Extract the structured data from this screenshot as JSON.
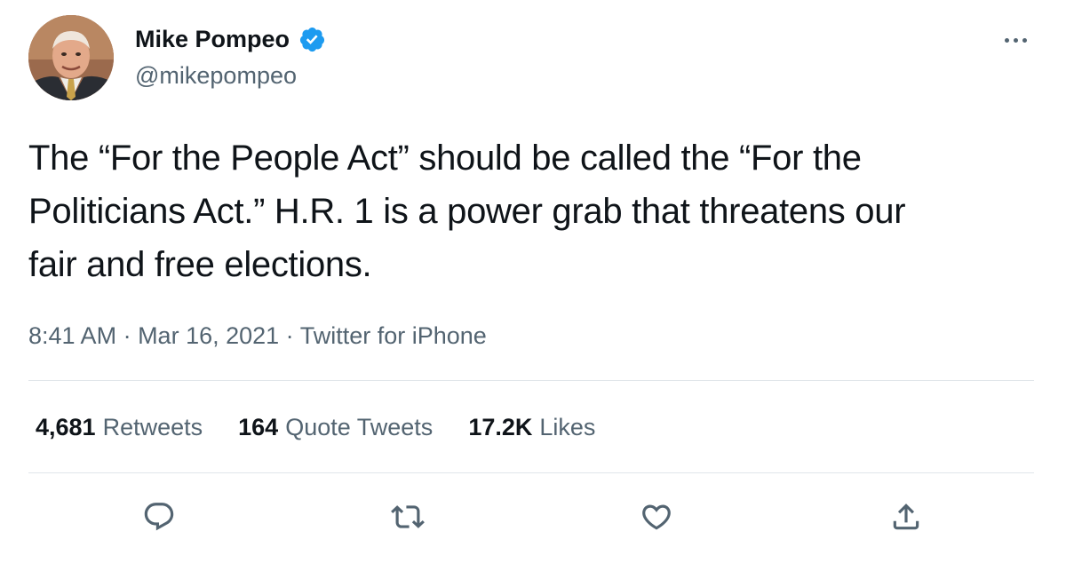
{
  "author": {
    "display_name": "Mike Pompeo",
    "handle": "@mikepompeo",
    "verified": true
  },
  "tweet": {
    "text_lines": [
      "The “For the People Act” should be called the “For the",
      "Politicians Act.” H.R. 1 is a power grab that threatens our",
      "fair and free elections."
    ],
    "time": "8:41 AM",
    "date": "Mar 16, 2021",
    "source": "Twitter for iPhone",
    "separator": " · "
  },
  "stats": {
    "retweets": {
      "count": "4,681",
      "label": "Retweets"
    },
    "quote_tweets": {
      "count": "164",
      "label": "Quote Tweets"
    },
    "likes": {
      "count": "17.2K",
      "label": "Likes"
    }
  },
  "icons": {
    "more": "more-horizontal-icon",
    "verified": "verified-badge-icon",
    "reply": "reply-icon",
    "retweet": "retweet-icon",
    "like": "heart-icon",
    "share": "share-icon"
  },
  "colors": {
    "text": "#0f1419",
    "secondary": "#536471",
    "verified": "#1d9bf0",
    "divider": "#e1e6ea"
  }
}
